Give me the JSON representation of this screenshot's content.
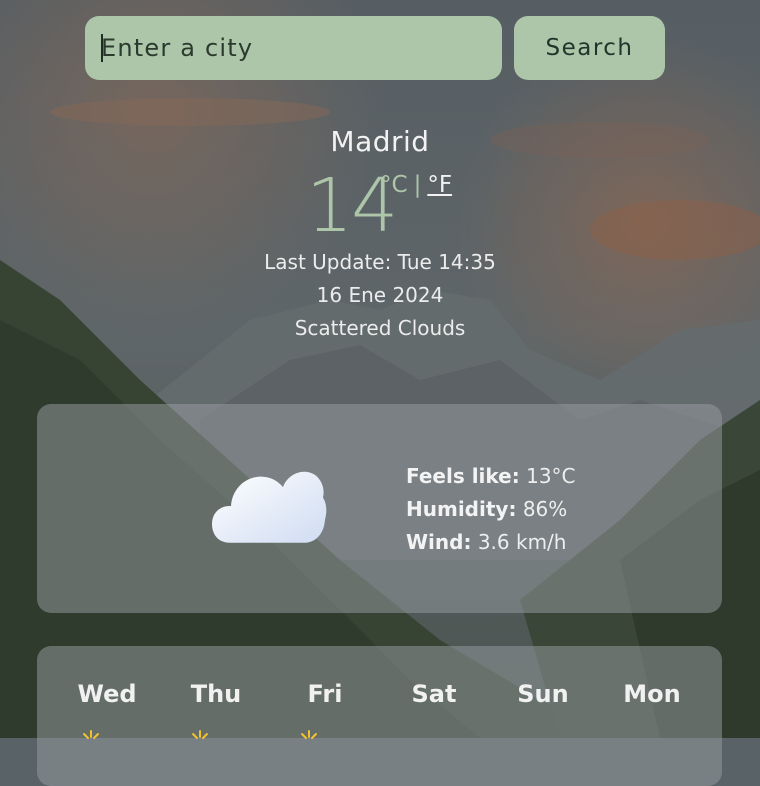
{
  "search": {
    "placeholder": "Enter a city",
    "button_label": "Search"
  },
  "current": {
    "city": "Madrid",
    "temperature": "14",
    "unit_celsius": "°C",
    "unit_separator": "|",
    "unit_fahrenheit": "°F",
    "last_update": "Last Update: Tue 14:35",
    "date": "16 Ene 2024",
    "condition": "Scattered Clouds",
    "icon": "cloud-icon"
  },
  "details": {
    "feels_like_label": "Feels like:",
    "feels_like_value": "13°C",
    "humidity_label": "Humidity:",
    "humidity_value": "86%",
    "wind_label": "Wind:",
    "wind_value": "3.6 km/h"
  },
  "forecast": {
    "days": [
      {
        "name": "Wed",
        "icon": "sun-icon"
      },
      {
        "name": "Thu",
        "icon": "sun-icon"
      },
      {
        "name": "Fri",
        "icon": "sun-icon"
      },
      {
        "name": "Sat",
        "icon": ""
      },
      {
        "name": "Sun",
        "icon": ""
      },
      {
        "name": "Mon",
        "icon": ""
      }
    ]
  },
  "colors": {
    "accent": "#adc6aa",
    "card": "#969ca0",
    "sun": "#f2c233"
  }
}
